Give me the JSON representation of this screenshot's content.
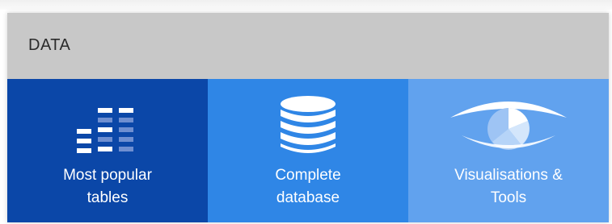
{
  "panel": {
    "title": "DATA"
  },
  "tiles": [
    {
      "label": "Most popular\ntables",
      "icon": "table-bars-icon",
      "color": "#0b47a8"
    },
    {
      "label": "Complete\ndatabase",
      "icon": "database-icon",
      "color": "#2f86e6"
    },
    {
      "label": "Visualisations &\nTools",
      "icon": "eye-icon",
      "color": "#61a2ee"
    }
  ]
}
